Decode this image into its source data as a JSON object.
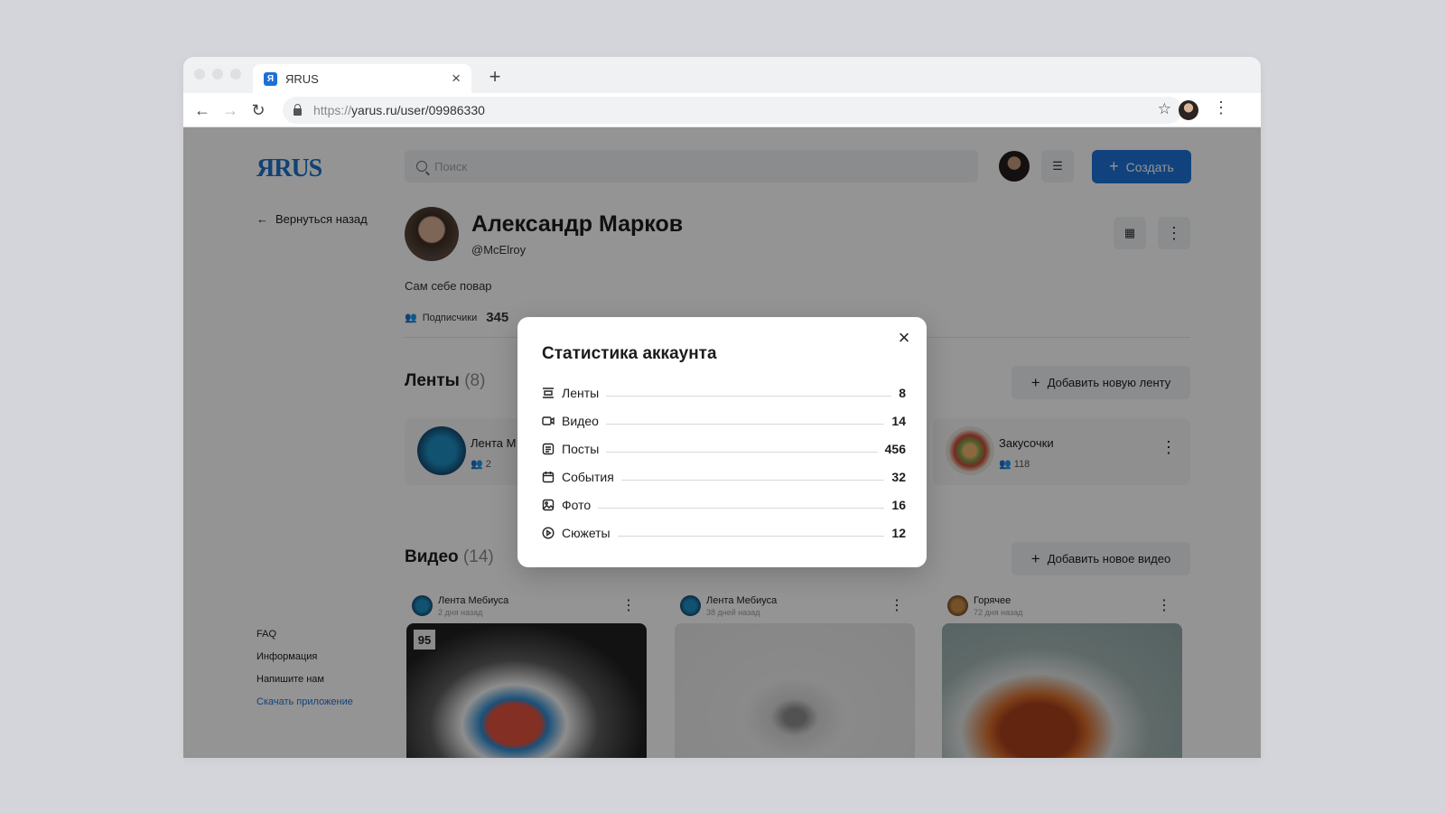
{
  "browser": {
    "tab_title": "ЯRUS",
    "tab_close": "×",
    "new_tab": "+",
    "url_proto": "https://",
    "url_main": "yarus.ru/user/09986330"
  },
  "app": {
    "logo": "ЯRUS",
    "search_placeholder": "Поиск",
    "create_label": "Создать",
    "back_label": "Вернуться назад"
  },
  "profile": {
    "name": "Александр Марков",
    "handle": "@McElroy",
    "bio": "Сам себе повар",
    "subscribers_label": "Подписчики",
    "subscribers_count": "345"
  },
  "feeds": {
    "title": "Ленты",
    "count": "(8)",
    "add_label": "Добавить новую ленту",
    "items": [
      {
        "name": "Лента М",
        "members": "2"
      },
      {
        "name": "Закусочки",
        "members": "118"
      }
    ]
  },
  "videos": {
    "title": "Видео",
    "count": "(14)",
    "add_label": "Добавить новое видео",
    "items": [
      {
        "title": "Лента Мебиуса",
        "date": "2 дня назад",
        "badge": "95"
      },
      {
        "title": "Лента Мебиуса",
        "date": "38 дней назад"
      },
      {
        "title": "Горячее",
        "date": "72 дня назад"
      }
    ]
  },
  "footer": {
    "links": [
      "FAQ",
      "Информация",
      "Напишите нам",
      "Скачать приложение"
    ]
  },
  "modal": {
    "title": "Статистика аккаунта",
    "stats": [
      {
        "label": "Ленты",
        "value": "8",
        "icon": "feeds-icon"
      },
      {
        "label": "Видео",
        "value": "14",
        "icon": "video-icon"
      },
      {
        "label": "Посты",
        "value": "456",
        "icon": "posts-icon"
      },
      {
        "label": "События",
        "value": "32",
        "icon": "calendar-icon"
      },
      {
        "label": "Фото",
        "value": "16",
        "icon": "photo-icon"
      },
      {
        "label": "Сюжеты",
        "value": "12",
        "icon": "stories-icon"
      }
    ]
  },
  "colors": {
    "accent": "#1e73d8",
    "overlay": "rgba(0,0,0,0.42)"
  }
}
